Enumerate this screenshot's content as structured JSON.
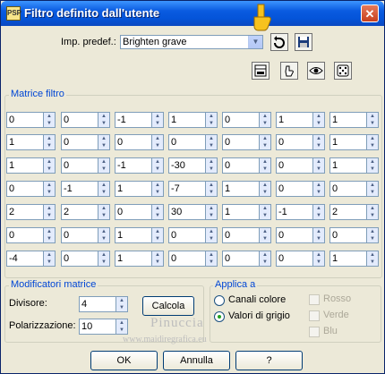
{
  "title": "Filtro definito dall'utente",
  "preset_label": "Imp. predef.:",
  "preset_value": "Brighten grave",
  "matrix_title": "Matrice filtro",
  "matrix": [
    [
      "0",
      "0",
      "-1",
      "1",
      "0",
      "1",
      "1"
    ],
    [
      "1",
      "0",
      "0",
      "0",
      "0",
      "0",
      "1"
    ],
    [
      "1",
      "0",
      "-1",
      "-30",
      "0",
      "0",
      "1"
    ],
    [
      "0",
      "-1",
      "1",
      "-7",
      "1",
      "0",
      "0"
    ],
    [
      "2",
      "2",
      "0",
      "30",
      "1",
      "-1",
      "2"
    ],
    [
      "0",
      "0",
      "1",
      "0",
      "0",
      "0",
      "0"
    ],
    [
      "-4",
      "0",
      "1",
      "0",
      "0",
      "0",
      "1"
    ]
  ],
  "modifiers": {
    "title": "Modificatori matrice",
    "divisor_label": "Divisore:",
    "divisor_value": "4",
    "bias_label": "Polarizzazione:",
    "bias_value": "10",
    "calc_label": "Calcola"
  },
  "apply": {
    "title": "Applica a",
    "color_channels": "Canali colore",
    "gray_values": "Valori di grigio",
    "red": "Rosso",
    "green": "Verde",
    "blue": "Blu",
    "selected": "gray_values"
  },
  "buttons": {
    "ok": "OK",
    "cancel": "Annulla",
    "help": "?"
  },
  "watermark": {
    "name": "Pinuccia",
    "site": "www.maidiregrafica.eu"
  }
}
